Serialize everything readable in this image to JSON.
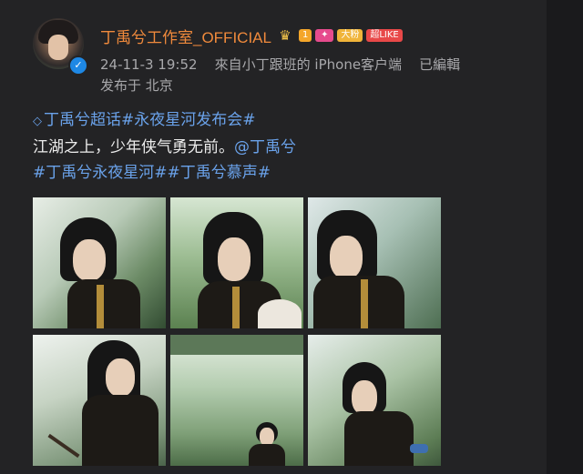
{
  "author": {
    "name": "丁禹兮工作室_OFFICIAL",
    "level_badge": "1",
    "fan_badge": "大粉",
    "like_badge": "超LIKE"
  },
  "meta": {
    "datetime": "24-11-3 19:52",
    "source": "來自小丁跟班的 iPhone客户端",
    "edited": "已編輯",
    "location": "发布于 北京"
  },
  "content": {
    "line1": "丁禹兮超话#永夜星河发布会#",
    "line2_text": "江湖之上，少年侠气勇无前。",
    "line2_mention": "@丁禹兮",
    "line3": "#丁禹兮永夜星河##丁禹兮慕声#"
  },
  "photos": [
    {
      "name": "photo-1"
    },
    {
      "name": "photo-2"
    },
    {
      "name": "photo-3"
    },
    {
      "name": "photo-4"
    },
    {
      "name": "photo-5"
    },
    {
      "name": "photo-6"
    }
  ]
}
